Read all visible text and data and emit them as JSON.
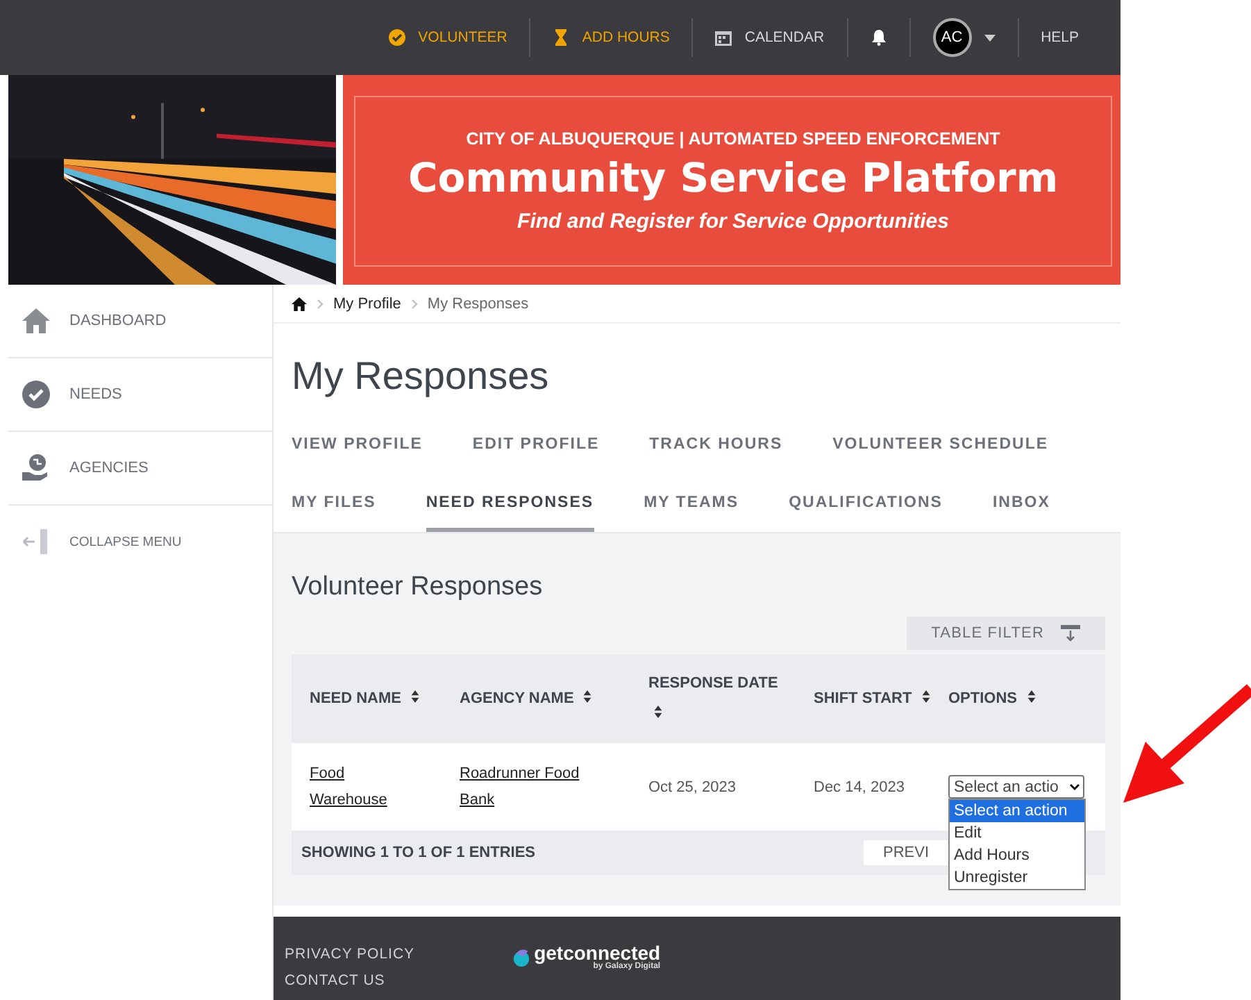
{
  "topbar": {
    "items": [
      {
        "kind": "check",
        "label": "VOLUNTEER",
        "accent": true
      },
      {
        "kind": "hourglass",
        "label": "ADD HOURS",
        "accent": true
      },
      {
        "kind": "calendar",
        "label": "CALENDAR",
        "accent": false
      },
      {
        "kind": "bell"
      },
      {
        "kind": "avatar",
        "label": "AC"
      },
      {
        "kind": "text",
        "label": "HELP",
        "accent": false
      }
    ]
  },
  "banner": {
    "kicker": "CITY OF ALBUQUERQUE | AUTOMATED SPEED ENFORCEMENT",
    "title": "Community Service Platform",
    "subtitle": "Find and Register for Service Opportunities"
  },
  "sidebar": {
    "items": [
      {
        "kind": "home",
        "label": "DASHBOARD"
      },
      {
        "kind": "check",
        "label": "NEEDS"
      },
      {
        "kind": "globe",
        "label": "AGENCIES"
      },
      {
        "kind": "collapse",
        "label": "COLLAPSE MENU"
      }
    ]
  },
  "breadcrumb": [
    "My Profile",
    "My Responses"
  ],
  "page_title": "My Responses",
  "tab_rows": [
    [
      {
        "label": "VIEW PROFILE",
        "selected": false
      },
      {
        "label": "EDIT PROFILE",
        "selected": false
      },
      {
        "label": "TRACK HOURS",
        "selected": false
      },
      {
        "label": "VOLUNTEER SCHEDULE",
        "selected": false
      }
    ],
    [
      {
        "label": "MY FILES",
        "selected": false
      },
      {
        "label": "NEED RESPONSES",
        "selected": true
      },
      {
        "label": "MY TEAMS",
        "selected": false
      },
      {
        "label": "QUALIFICATIONS",
        "selected": false
      },
      {
        "label": "INBOX",
        "selected": false
      }
    ]
  ],
  "section_title": "Volunteer Responses",
  "table_filter": "TABLE FILTER",
  "table": {
    "columns": [
      "NEED NAME",
      "AGENCY NAME",
      "RESPONSE DATE",
      "SHIFT START",
      "OPTIONS"
    ],
    "rows": [
      {
        "need": "Food Warehouse",
        "agency": "Roadrunner Food Bank",
        "response_date": "Oct 25, 2023",
        "shift_start": "Dec 14, 2023",
        "action": "Select an actio",
        "options": [
          {
            "label": "Select an action",
            "selected": true
          },
          {
            "label": "Edit",
            "selected": false
          },
          {
            "label": "Add Hours",
            "selected": false
          },
          {
            "label": "Unregister",
            "selected": false
          }
        ]
      }
    ],
    "showing": "SHOWING 1 TO 1 OF 1 ENTRIES",
    "pager": "PREVI"
  },
  "footer": {
    "links": [
      "PRIVACY POLICY",
      "CONTACT US"
    ],
    "logo": "getconnected",
    "logo_sub": "by Galaxy Digital"
  }
}
